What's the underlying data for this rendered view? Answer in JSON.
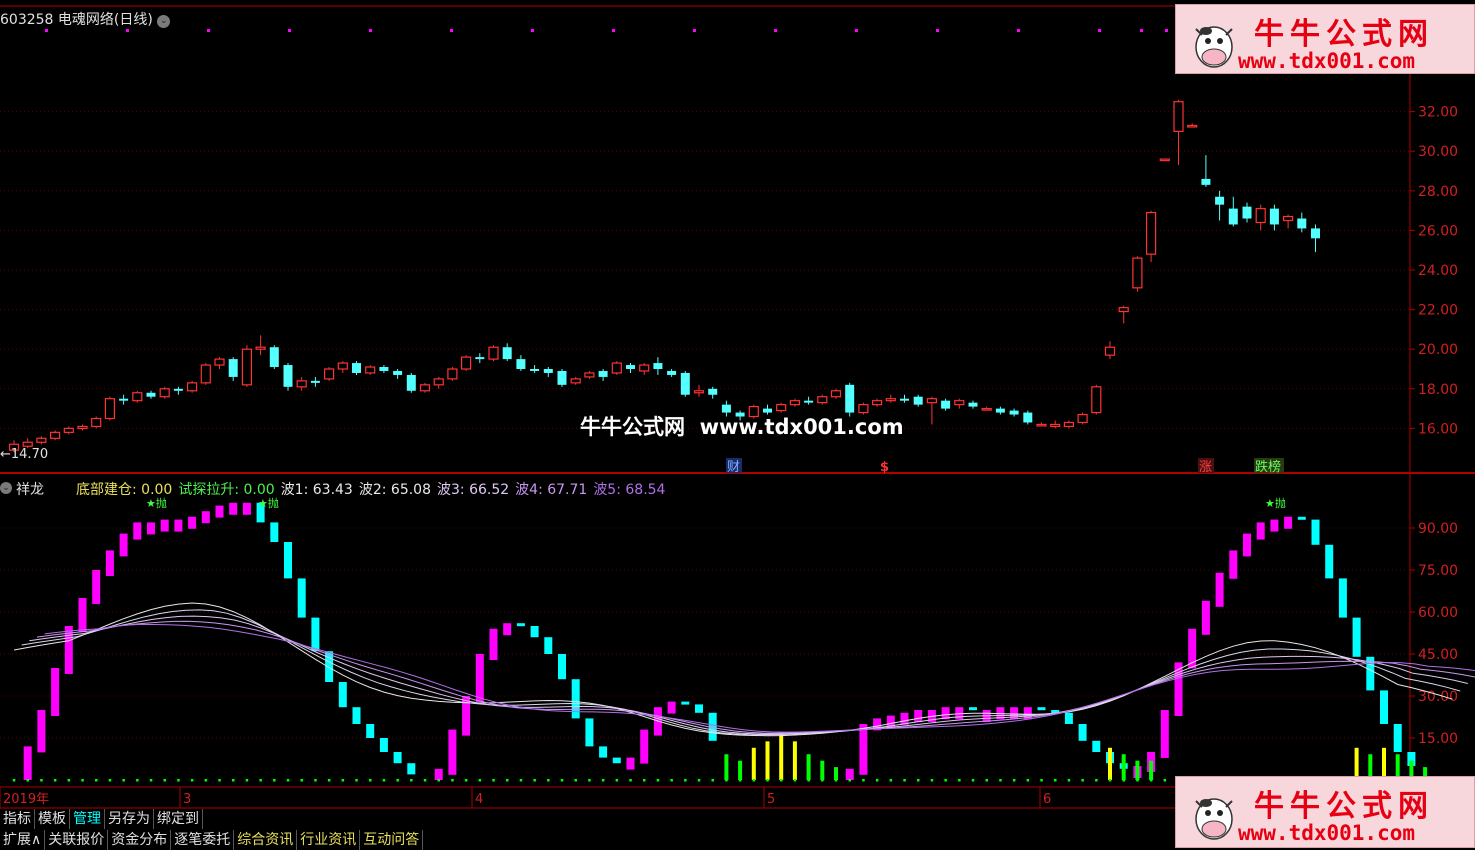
{
  "header": {
    "stock_title": "603258 电魂网络(日线)",
    "indicator_name": "祥龙",
    "legend": [
      {
        "label": "底部建仓:",
        "value": "0.00",
        "color": "#e8e05a"
      },
      {
        "label": "试探拉升:",
        "value": "0.00",
        "color": "#4cf04c"
      },
      {
        "label": "波1:",
        "value": "63.43",
        "color": "#e8e8e8"
      },
      {
        "label": "波2:",
        "value": "65.08",
        "color": "#e8e8e8"
      },
      {
        "label": "波3:",
        "value": "66.52",
        "color": "#e0c8f0"
      },
      {
        "label": "波4:",
        "value": "67.71",
        "color": "#c898f0"
      },
      {
        "label": "波5:",
        "value": "68.54",
        "color": "#b070e8"
      }
    ]
  },
  "watermark": {
    "text": "牛牛公式网  www.tdx001.com"
  },
  "brand": {
    "name": "牛牛公式网",
    "url": "www.tdx001.com"
  },
  "markers": {
    "cai": "财",
    "dollar": "$",
    "zhang": "涨",
    "dieban": "跌榜",
    "min_price": "←14.70",
    "throw": "抛"
  },
  "colors": {
    "up": "#ff3232",
    "down": "#54ffff",
    "axis": "#b00000",
    "magenta": "#ff00ff",
    "cyan": "#00ffff",
    "green": "#00ff00",
    "yellow": "#ffff00"
  },
  "chart_data": [
    {
      "type": "candlestick",
      "yaxis_ticks": [
        "16.00",
        "18.00",
        "20.00",
        "22.00",
        "24.00",
        "26.00",
        "28.00",
        "30.00",
        "32.00"
      ],
      "ylim": [
        14.0,
        34.0
      ],
      "x_labels": [],
      "candles": [
        [
          14.9,
          15.2,
          15.4,
          14.8
        ],
        [
          15.1,
          15.3,
          15.5,
          15.0
        ],
        [
          15.3,
          15.5,
          15.6,
          15.2
        ],
        [
          15.5,
          15.8,
          15.9,
          15.4
        ],
        [
          15.8,
          16.0,
          16.1,
          15.7
        ],
        [
          16.0,
          16.1,
          16.2,
          15.9
        ],
        [
          16.1,
          16.5,
          16.6,
          16.0
        ],
        [
          16.5,
          17.5,
          17.6,
          16.4
        ],
        [
          17.5,
          17.4,
          17.7,
          17.2
        ],
        [
          17.4,
          17.8,
          17.9,
          17.3
        ],
        [
          17.8,
          17.6,
          17.9,
          17.5
        ],
        [
          17.6,
          18.0,
          18.1,
          17.5
        ],
        [
          18.0,
          17.9,
          18.1,
          17.7
        ],
        [
          17.9,
          18.3,
          18.4,
          17.8
        ],
        [
          18.3,
          19.2,
          19.3,
          18.2
        ],
        [
          19.2,
          19.5,
          19.6,
          19.0
        ],
        [
          19.5,
          18.6,
          19.6,
          18.4
        ],
        [
          18.2,
          20.0,
          20.2,
          18.1
        ],
        [
          20.0,
          20.1,
          20.7,
          19.7
        ],
        [
          20.1,
          19.1,
          20.2,
          19.0
        ],
        [
          19.2,
          18.1,
          19.3,
          17.9
        ],
        [
          18.1,
          18.4,
          18.6,
          17.9
        ],
        [
          18.4,
          18.3,
          18.6,
          18.1
        ],
        [
          18.5,
          19.0,
          19.1,
          18.4
        ],
        [
          19.0,
          19.3,
          19.4,
          18.8
        ],
        [
          19.3,
          18.8,
          19.4,
          18.7
        ],
        [
          18.8,
          19.1,
          19.2,
          18.7
        ],
        [
          19.1,
          18.9,
          19.2,
          18.8
        ],
        [
          18.9,
          18.7,
          19.0,
          18.5
        ],
        [
          18.7,
          17.9,
          18.8,
          17.8
        ],
        [
          17.9,
          18.2,
          18.3,
          17.8
        ],
        [
          18.2,
          18.5,
          18.6,
          18.0
        ],
        [
          18.5,
          19.0,
          19.1,
          18.4
        ],
        [
          19.0,
          19.6,
          19.7,
          18.9
        ],
        [
          19.6,
          19.5,
          19.8,
          19.3
        ],
        [
          19.5,
          20.1,
          20.2,
          19.4
        ],
        [
          20.1,
          19.5,
          20.3,
          19.4
        ],
        [
          19.5,
          19.0,
          19.7,
          18.9
        ],
        [
          19.0,
          18.9,
          19.2,
          18.8
        ],
        [
          19.0,
          18.8,
          19.1,
          18.6
        ],
        [
          18.9,
          18.2,
          19.0,
          18.1
        ],
        [
          18.3,
          18.5,
          18.6,
          18.2
        ],
        [
          18.6,
          18.8,
          18.9,
          18.5
        ],
        [
          18.9,
          18.6,
          19.0,
          18.4
        ],
        [
          18.8,
          19.3,
          19.4,
          18.7
        ],
        [
          19.2,
          19.0,
          19.3,
          18.8
        ],
        [
          18.9,
          19.2,
          19.3,
          18.7
        ],
        [
          19.3,
          19.0,
          19.6,
          18.7
        ],
        [
          18.9,
          18.7,
          19.0,
          18.6
        ],
        [
          18.8,
          17.7,
          18.9,
          17.6
        ],
        [
          17.8,
          17.9,
          18.2,
          17.6
        ],
        [
          18.0,
          17.7,
          18.1,
          17.5
        ],
        [
          17.2,
          16.8,
          17.4,
          16.6
        ],
        [
          16.8,
          16.6,
          16.9,
          16.4
        ],
        [
          16.6,
          17.1,
          17.2,
          16.5
        ],
        [
          17.0,
          16.8,
          17.2,
          16.7
        ],
        [
          16.9,
          17.2,
          17.3,
          16.8
        ],
        [
          17.2,
          17.4,
          17.5,
          17.1
        ],
        [
          17.4,
          17.3,
          17.6,
          17.2
        ],
        [
          17.3,
          17.6,
          17.7,
          17.2
        ],
        [
          17.6,
          17.9,
          18.0,
          17.5
        ],
        [
          18.2,
          16.8,
          18.3,
          16.6
        ],
        [
          16.8,
          17.2,
          17.3,
          16.7
        ],
        [
          17.2,
          17.4,
          17.5,
          17.1
        ],
        [
          17.4,
          17.5,
          17.7,
          17.3
        ],
        [
          17.5,
          17.4,
          17.7,
          17.3
        ],
        [
          17.6,
          17.2,
          17.7,
          17.1
        ],
        [
          17.3,
          17.5,
          17.6,
          16.2
        ],
        [
          17.4,
          17.0,
          17.5,
          16.9
        ],
        [
          17.2,
          17.4,
          17.5,
          17.0
        ],
        [
          17.3,
          17.1,
          17.4,
          17.0
        ],
        [
          17.0,
          17.0,
          17.1,
          16.9
        ],
        [
          17.0,
          16.8,
          17.1,
          16.7
        ],
        [
          16.9,
          16.7,
          17.0,
          16.6
        ],
        [
          16.8,
          16.3,
          16.9,
          16.2
        ],
        [
          16.2,
          16.2,
          16.3,
          16.1
        ],
        [
          16.1,
          16.2,
          16.4,
          16.0
        ],
        [
          16.1,
          16.3,
          16.4,
          16.0
        ],
        [
          16.3,
          16.7,
          16.8,
          16.2
        ],
        [
          16.8,
          18.1,
          18.2,
          16.7
        ],
        [
          19.7,
          20.1,
          20.4,
          19.5
        ],
        [
          21.9,
          22.1,
          22.2,
          21.3
        ],
        [
          23.1,
          24.6,
          24.7,
          22.9
        ],
        [
          24.8,
          26.9,
          27.0,
          24.4
        ],
        [
          29.6,
          29.6,
          29.6,
          29.6
        ],
        [
          31.0,
          32.5,
          32.6,
          29.3
        ],
        [
          31.3,
          31.3,
          31.4,
          31.2
        ],
        [
          28.6,
          28.3,
          29.8,
          28.2
        ],
        [
          27.7,
          27.3,
          28.0,
          26.5
        ],
        [
          27.1,
          26.3,
          27.7,
          26.2
        ],
        [
          27.2,
          26.6,
          27.4,
          26.4
        ],
        [
          26.4,
          27.1,
          27.3,
          26.0
        ],
        [
          27.1,
          26.3,
          27.3,
          26.0
        ],
        [
          26.5,
          26.7,
          26.8,
          26.1
        ],
        [
          26.6,
          26.1,
          26.9,
          25.9
        ],
        [
          26.1,
          25.6,
          26.3,
          24.9
        ]
      ]
    },
    {
      "type": "bar",
      "yaxis_ticks": [
        "15.00",
        "30.00",
        "45.00",
        "60.00",
        "75.00",
        "90.00"
      ],
      "ylim": [
        0,
        100
      ],
      "x_labels": [
        "2019年",
        "3",
        "4",
        "5",
        "6"
      ],
      "bars": [
        0,
        12,
        25,
        40,
        55,
        65,
        75,
        82,
        88,
        92,
        92,
        93,
        93,
        94,
        96,
        98,
        99,
        99,
        92,
        85,
        72,
        58,
        46,
        35,
        26,
        20,
        15,
        10,
        6,
        2,
        0,
        4,
        18,
        30,
        45,
        54,
        56,
        55,
        51,
        45,
        36,
        22,
        12,
        8,
        6,
        8,
        18,
        26,
        28,
        27,
        24,
        14,
        0,
        0,
        0,
        0,
        0,
        0,
        0,
        0,
        0,
        4,
        20,
        22,
        23,
        24,
        25,
        25,
        26,
        26,
        25,
        25,
        26,
        26,
        26,
        25,
        24,
        20,
        14,
        10,
        6,
        4,
        5,
        10,
        25,
        42,
        54,
        64,
        74,
        82,
        88,
        92,
        93,
        94,
        93,
        84,
        72,
        58,
        44,
        32,
        20,
        10,
        5,
        0,
        0,
        0
      ],
      "small_bars": [
        0,
        0,
        0,
        0,
        0,
        0,
        0,
        0,
        0,
        0,
        0,
        0,
        0,
        0,
        0,
        0,
        0,
        0,
        0,
        0,
        0,
        0,
        0,
        0,
        0,
        0,
        0,
        0,
        0,
        0,
        0,
        0,
        0,
        0,
        0,
        0,
        0,
        0,
        0,
        0,
        0,
        0,
        0,
        0,
        0,
        0,
        0,
        0,
        0,
        0,
        0,
        0,
        4,
        3,
        5,
        6,
        7,
        6,
        4,
        3,
        2,
        0,
        0,
        0,
        0,
        0,
        0,
        0,
        0,
        0,
        0,
        0,
        0,
        0,
        0,
        0,
        0,
        0,
        0,
        0,
        5,
        4,
        3,
        3,
        0,
        0,
        0,
        0,
        0,
        0,
        0,
        0,
        0,
        0,
        0,
        0,
        0,
        0,
        5,
        4,
        5,
        4,
        3,
        2,
        0,
        0
      ]
    }
  ]
}
